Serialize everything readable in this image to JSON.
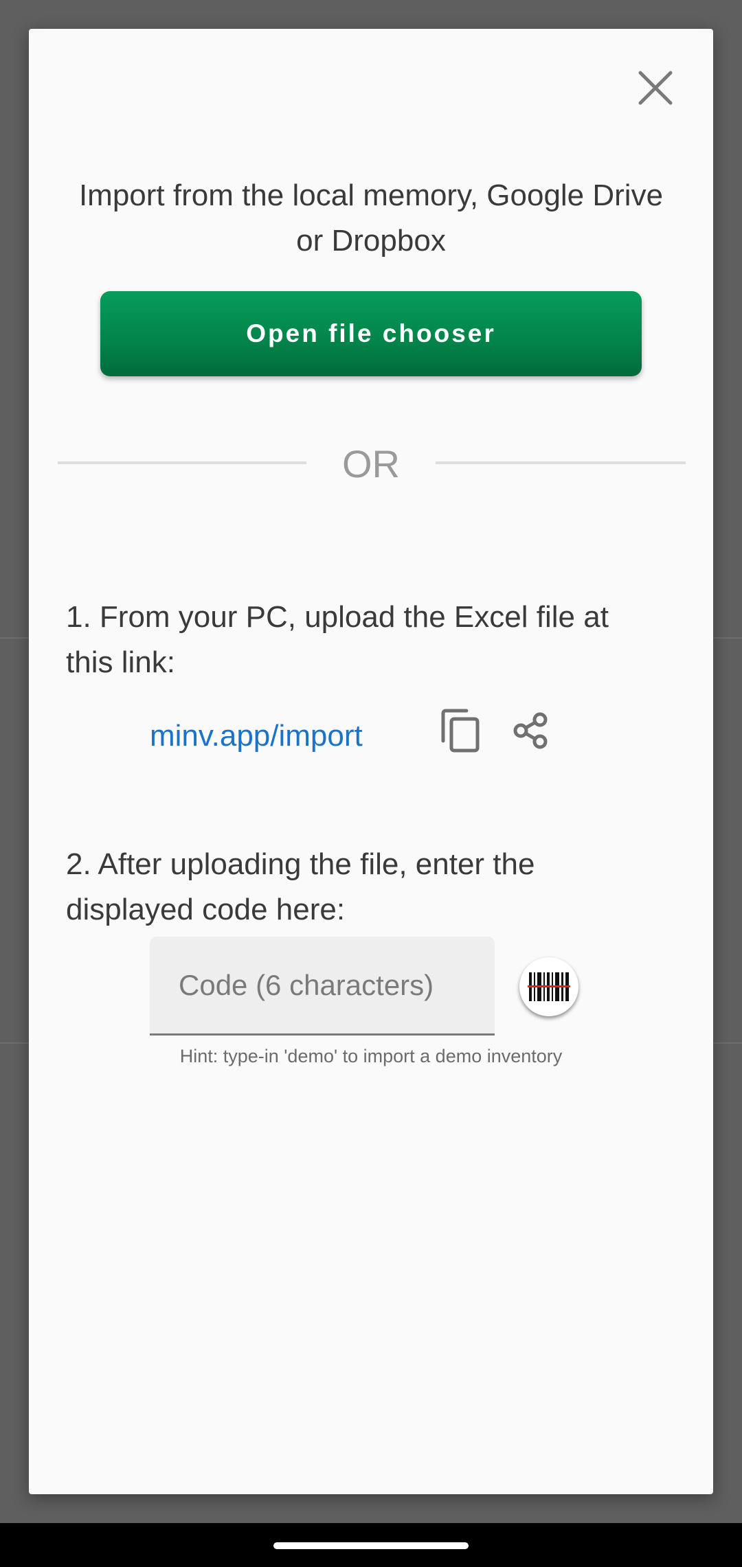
{
  "dialog": {
    "intro_line1": "Import from the local memory, Google Drive",
    "intro_line2": "or Dropbox",
    "open_file_chooser_label": "Open file chooser",
    "or_label": "OR",
    "step1_line1": "1. From your PC, upload the Excel file at",
    "step1_line2": "this link:",
    "import_link": "minv.app/import",
    "step2_line1": "2. After uploading the file, enter the",
    "step2_line2": "displayed code here:",
    "code_input": {
      "placeholder": "Code (6 characters)",
      "value": ""
    },
    "hint": "Hint: type-in 'demo' to import a demo inventory"
  },
  "icons": {
    "close": "close-icon",
    "copy": "copy-icon",
    "share": "share-icon",
    "barcode": "barcode-scan-icon"
  },
  "colors": {
    "primary_button": "#03834a",
    "link": "#1a73c8",
    "text": "#3a3a3a",
    "dialog_background": "#fafafa",
    "scrim": "#5f5f5f"
  }
}
